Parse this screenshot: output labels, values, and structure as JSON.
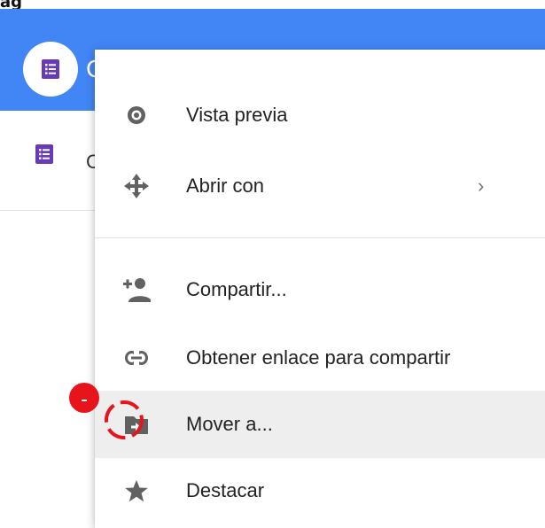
{
  "page_caption": "ag",
  "background": {
    "selected_row_label": "C",
    "row_label": "C"
  },
  "context_menu": {
    "items": [
      {
        "label": "Vista previa",
        "icon": "eye-icon"
      },
      {
        "label": "Abrir con",
        "icon": "move-arrows-icon",
        "submenu_indicator": "›"
      },
      {
        "label": "Compartir...",
        "icon": "person-add-icon"
      },
      {
        "label": "Obtener enlace para compartir",
        "icon": "link-icon"
      },
      {
        "label": "Mover a...",
        "icon": "folder-move-icon",
        "highlighted": true
      },
      {
        "label": "Destacar",
        "icon": "star-icon"
      }
    ]
  },
  "colors": {
    "header_blue": "#4285f4",
    "forms_purple": "#673ab7",
    "icon_gray": "#616161",
    "annotation_red": "#e8141c",
    "highlight_gray": "#eeeeee"
  }
}
